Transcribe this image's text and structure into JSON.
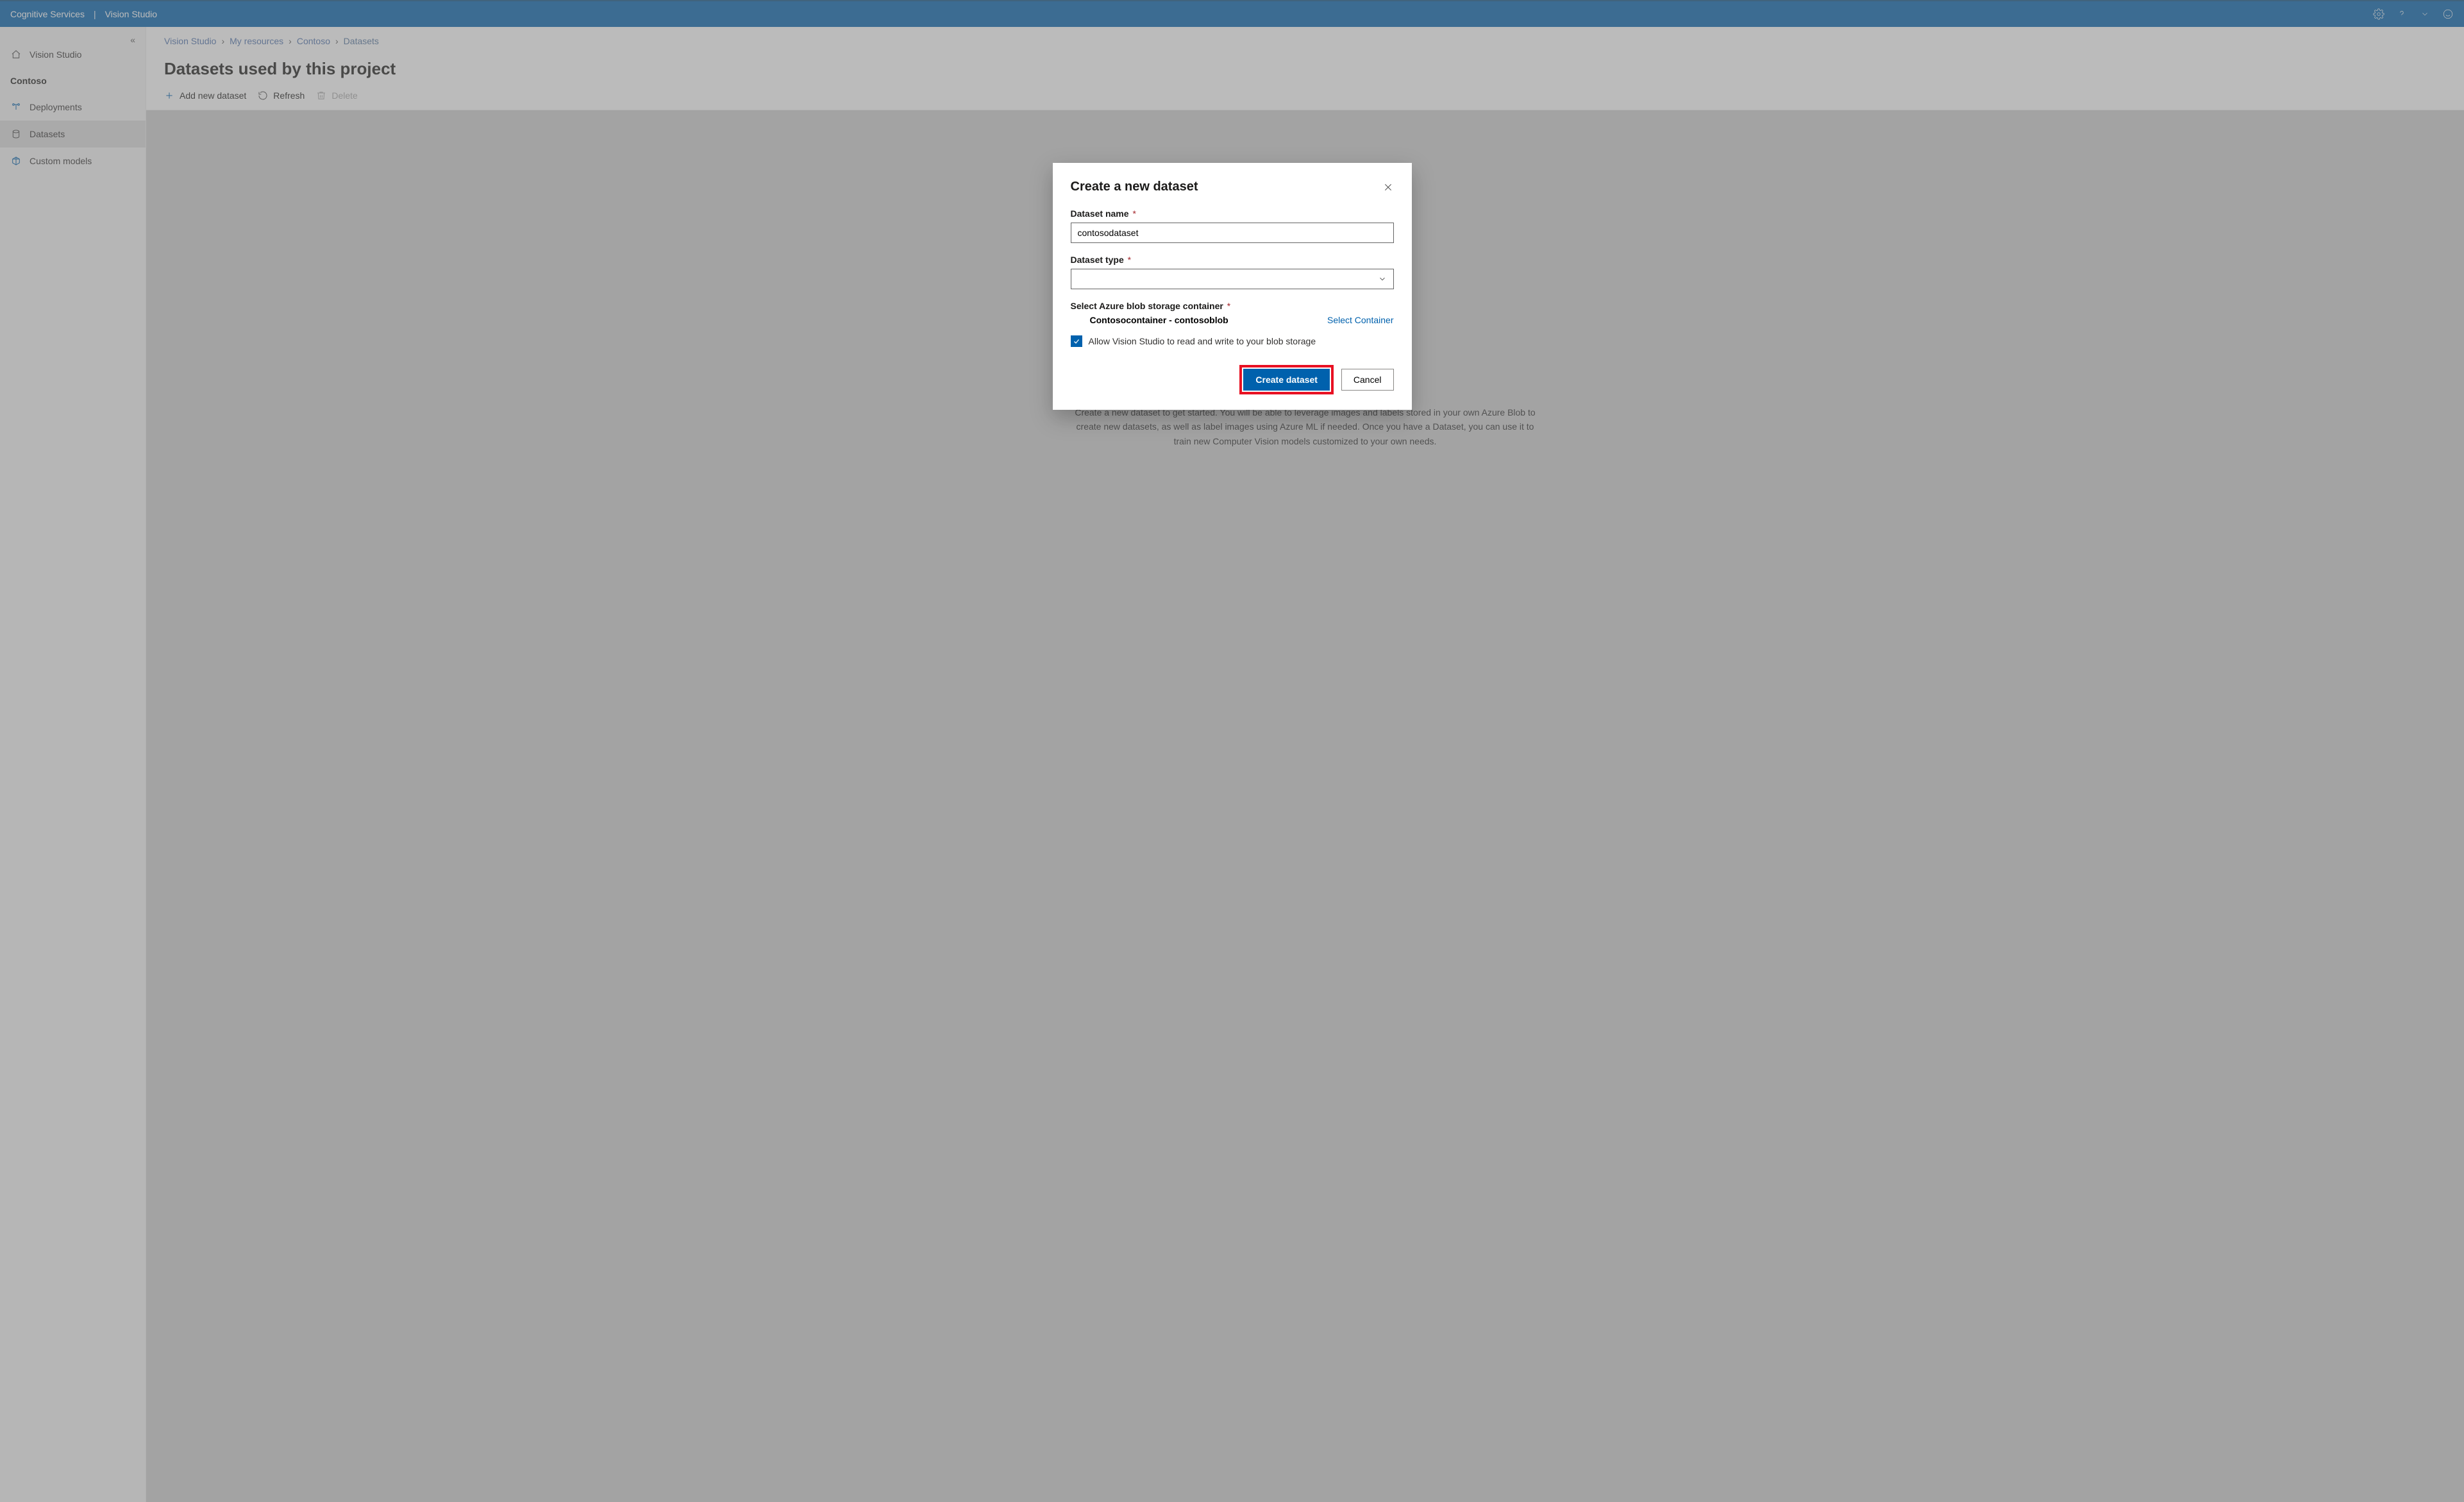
{
  "topbar": {
    "brand": "Cognitive Services",
    "app": "Vision Studio"
  },
  "sidebar": {
    "home": "Vision Studio",
    "project": "Contoso",
    "items": [
      {
        "label": "Deployments"
      },
      {
        "label": "Datasets"
      },
      {
        "label": "Custom models"
      }
    ]
  },
  "breadcrumbs": [
    "Vision Studio",
    "My resources",
    "Contoso",
    "Datasets"
  ],
  "page": {
    "title": "Datasets used by this project"
  },
  "toolbar": {
    "add": "Add new dataset",
    "refresh": "Refresh",
    "delete": "Delete"
  },
  "canvas": {
    "description": "Create a new dataset to get started. You will be able to leverage images and labels stored in your own Azure Blob to create new datasets, as well as label images using Azure ML if needed. Once you have a Dataset, you can use it to train new Computer Vision models customized to your own needs."
  },
  "modal": {
    "title": "Create a new dataset",
    "name_label": "Dataset name",
    "name_value": "contosodataset",
    "type_label": "Dataset type",
    "type_value": "",
    "container_label": "Select Azure blob storage container",
    "container_value": "Contosocontainer - contosoblob",
    "select_container_link": "Select Container",
    "allow_rw_label": "Allow Vision Studio to read and write to your blob storage",
    "allow_rw_checked": true,
    "create_btn": "Create dataset",
    "cancel_btn": "Cancel",
    "required_marker": "*"
  }
}
